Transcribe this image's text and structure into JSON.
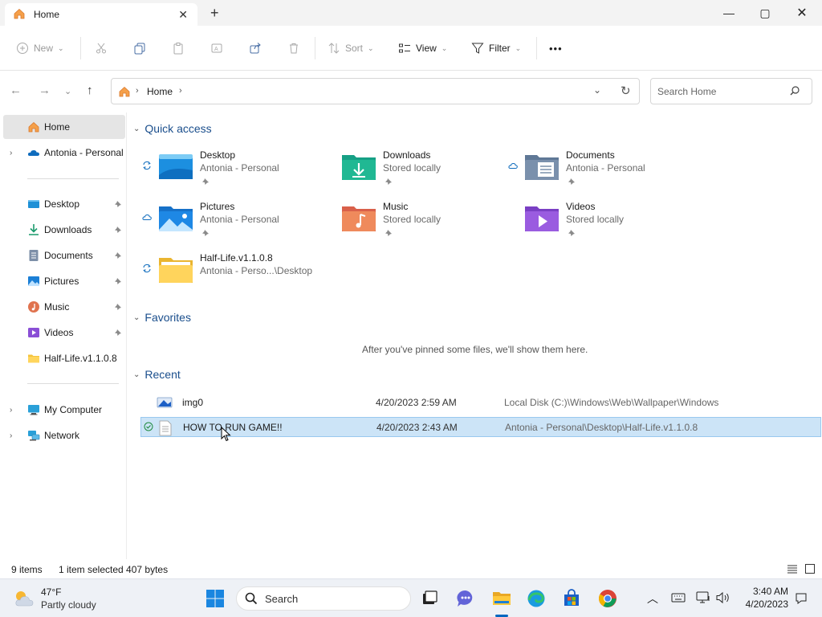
{
  "window": {
    "tab_title": "Home",
    "tab_close": "✕",
    "new_tab": "+",
    "minimize": "—",
    "maximize": "▢",
    "close": "✕"
  },
  "commandbar": {
    "new": "New",
    "sort": "Sort",
    "view": "View",
    "filter": "Filter",
    "more": "•••"
  },
  "address": {
    "crumb": "Home"
  },
  "search": {
    "placeholder": "Search Home"
  },
  "sidebar": {
    "home": "Home",
    "onedrive": "Antonia - Personal",
    "pinned": [
      {
        "label": "Desktop"
      },
      {
        "label": "Downloads"
      },
      {
        "label": "Documents"
      },
      {
        "label": "Pictures"
      },
      {
        "label": "Music"
      },
      {
        "label": "Videos"
      },
      {
        "label": "Half-Life.v1.1.0.8"
      }
    ],
    "my_computer": "My Computer",
    "network": "Network"
  },
  "quick_access": {
    "heading": "Quick access",
    "items": [
      {
        "name": "Desktop",
        "sub": "Antonia - Personal",
        "status": "sync",
        "icon": "desktop-folder"
      },
      {
        "name": "Downloads",
        "sub": "Stored locally",
        "status": "none",
        "icon": "downloads-folder"
      },
      {
        "name": "Documents",
        "sub": "Antonia - Personal",
        "status": "cloud",
        "icon": "documents-folder"
      },
      {
        "name": "Pictures",
        "sub": "Antonia - Personal",
        "status": "cloud",
        "icon": "pictures-folder"
      },
      {
        "name": "Music",
        "sub": "Stored locally",
        "status": "none",
        "icon": "music-folder"
      },
      {
        "name": "Videos",
        "sub": "Stored locally",
        "status": "none",
        "icon": "videos-folder"
      },
      {
        "name": "Half-Life.v1.1.0.8",
        "sub": "Antonia - Perso...\\Desktop",
        "status": "sync",
        "icon": "yellow-folder"
      }
    ]
  },
  "favorites": {
    "heading": "Favorites",
    "empty": "After you've pinned some files, we'll show them here."
  },
  "recent": {
    "heading": "Recent",
    "rows": [
      {
        "name": "img0",
        "date": "4/20/2023 2:59 AM",
        "location": "Local Disk (C:)\\Windows\\Web\\Wallpaper\\Windows"
      },
      {
        "name": "HOW TO RUN GAME!!",
        "date": "4/20/2023 2:43 AM",
        "location": "Antonia - Personal\\Desktop\\Half-Life.v1.1.0.8"
      }
    ]
  },
  "status": {
    "items": "9 items",
    "selected": "1 item selected  407 bytes"
  },
  "taskbar": {
    "temp": "47°F",
    "weather": "Partly cloudy",
    "search": "Search",
    "time": "3:40 AM",
    "date": "4/20/2023"
  },
  "colors": {
    "accent": "#0067c0",
    "selection": "#cce4f7",
    "heading": "#1a4e8c"
  }
}
